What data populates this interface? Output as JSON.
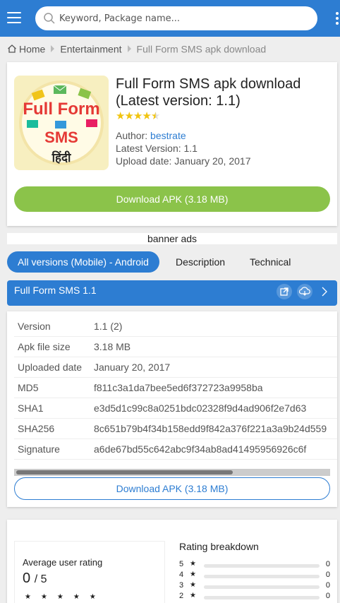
{
  "search": {
    "placeholder": "Keyword, Package name..."
  },
  "breadcrumb": {
    "home": "Home",
    "category": "Entertainment",
    "current": "Full Form SMS apk download"
  },
  "app": {
    "title": "Full Form SMS apk download (Latest version: 1.1)",
    "rating_stars": 4.5,
    "author_label": "Author:",
    "author": "bestrate",
    "latest_version": "Latest Version: 1.1",
    "upload_date": "Upload date: January 20, 2017",
    "download_button": "Download APK (3.18 MB)",
    "icon_text": {
      "line1": "Full Form",
      "line2": "SMS",
      "line3": "हिंदी"
    }
  },
  "banner": "banner ads",
  "tabs": [
    {
      "label": "All versions (Mobile) - Android",
      "active": true
    },
    {
      "label": "Description",
      "active": false
    },
    {
      "label": "Technical",
      "active": false
    }
  ],
  "version_bar": {
    "title": "Full Form SMS 1.1"
  },
  "details": [
    {
      "key": "Version",
      "value": "1.1 (2)"
    },
    {
      "key": "Apk file size",
      "value": "3.18 MB"
    },
    {
      "key": "Uploaded date",
      "value": "January 20, 2017"
    },
    {
      "key": "MD5",
      "value": "f811c3a1da7bee5ed6f372723a9958ba"
    },
    {
      "key": "SHA1",
      "value": "e3d5d1c99c8a0251bdc02328f9d4ad906f2e7d63"
    },
    {
      "key": "SHA256",
      "value": "8c651b79b4f34b158edd9f842a376f221a3a9b24d559"
    },
    {
      "key": "Signature",
      "value": "a6de67bd55c642abc9f34ab8ad41495956926c6f"
    }
  ],
  "details_download_button": "Download APK (3.18 MB)",
  "rating": {
    "average_label": "Average user rating",
    "average_value": "0",
    "average_max": "/ 5",
    "empty_stars": "★★★★★",
    "breakdown_title": "Rating breakdown",
    "breakdown": [
      {
        "stars": "5",
        "star_glyph": "★",
        "count": "0"
      },
      {
        "stars": "4",
        "star_glyph": "★",
        "count": "0"
      },
      {
        "stars": "3",
        "star_glyph": "★",
        "count": "0"
      },
      {
        "stars": "2",
        "star_glyph": "★",
        "count": "0"
      }
    ]
  },
  "colors": {
    "primary": "#2d7dd2",
    "download_green": "#8bc34a",
    "star": "#f1c40f"
  }
}
